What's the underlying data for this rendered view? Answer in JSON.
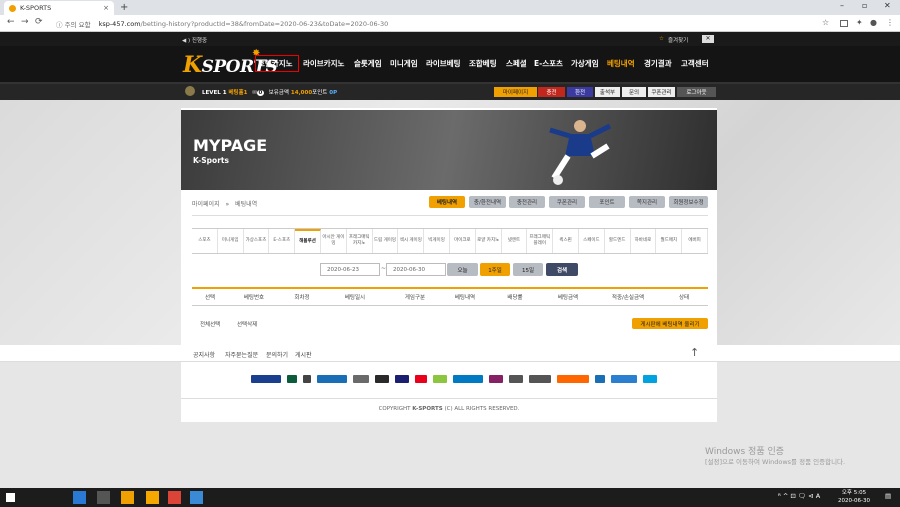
{
  "browser": {
    "tab_title": "K-SPORTS",
    "tab_close": "×",
    "new_tab": "+",
    "minimize": "–",
    "maximize": "▫",
    "close": "✕",
    "back": "←",
    "forward": "→",
    "reload": "⟳",
    "security": "ⓘ 주의 요함",
    "host": "ksp-457.com",
    "path": "/betting-history?productId=38&fromDate=2020-06-23&toDate=2020-06-30",
    "star": "☆",
    "profile": "●",
    "menu": "⋮",
    "icons": [
      "bookmark-star-icon",
      "extensions-icon",
      "profile-icon",
      "more-icon"
    ]
  },
  "site": {
    "top_strip": {
      "notice_label": "◀ ) 진행중",
      "favorite_label": "즐겨찾기",
      "favorite_glyph": "☆"
    },
    "logo": {
      "k": "K",
      "rest": "SPORTS"
    },
    "menu": [
      {
        "label": "호텔카지노",
        "highlight": false
      },
      {
        "label": "라이브카지노",
        "highlight": false
      },
      {
        "label": "슬롯게임",
        "highlight": false
      },
      {
        "label": "미니게임",
        "highlight": false
      },
      {
        "label": "라이브베팅",
        "highlight": false
      },
      {
        "label": "조합베팅",
        "highlight": false
      },
      {
        "label": "스페셜",
        "highlight": false
      },
      {
        "label": "E-스포츠",
        "highlight": false
      },
      {
        "label": "가상게임",
        "highlight": false
      },
      {
        "label": "베팅내역",
        "highlight": true
      },
      {
        "label": "경기결과",
        "highlight": false
      },
      {
        "label": "고객센터",
        "highlight": false
      }
    ],
    "user": {
      "level": "LEVEL 1",
      "nick": "베팅홀1",
      "msg_count": "0",
      "money_label": "보유금액",
      "money": "14,000",
      "point_label": "포인트",
      "point": "0P"
    },
    "user_buttons": [
      "마이페이지",
      "충전",
      "환전",
      "출석부",
      "문의",
      "쿠폰관리",
      "로그아웃"
    ],
    "banner": {
      "title": "MYPAGE",
      "subtitle": "K-Sports"
    },
    "breadcrumb": {
      "root": "마이페이지",
      "sep": "»",
      "current": "베팅내역"
    },
    "page_tabs": [
      {
        "label": "베팅내역",
        "on": true
      },
      {
        "label": "충/환전내역",
        "on": false
      },
      {
        "label": "충전관리",
        "on": false
      },
      {
        "label": "쿠폰관리",
        "on": false
      },
      {
        "label": "포인트",
        "on": false
      },
      {
        "label": "쪽지관리",
        "on": false
      },
      {
        "label": "회원정보수정",
        "on": false
      }
    ],
    "categories": [
      {
        "label": "스포츠",
        "on": false
      },
      {
        "label": "미니게임",
        "on": false
      },
      {
        "label": "가상스포츠",
        "on": false
      },
      {
        "label": "E-스포츠",
        "on": false
      },
      {
        "label": "해볼루션",
        "on": true
      },
      {
        "label": "아시안 게이밍",
        "on": false
      },
      {
        "label": "프래그매틱 카지노",
        "on": false
      },
      {
        "label": "드림 게이밍",
        "on": false
      },
      {
        "label": "섹시 게이밍",
        "on": false
      },
      {
        "label": "빅게이밍",
        "on": false
      },
      {
        "label": "마이크로",
        "on": false
      },
      {
        "label": "로얄 카지노",
        "on": false
      },
      {
        "label": "넷엔트",
        "on": false
      },
      {
        "label": "프래그매틱 플레이",
        "on": false
      },
      {
        "label": "퀵스핀",
        "on": false
      },
      {
        "label": "스페이드",
        "on": false
      },
      {
        "label": "할드엔드",
        "on": false
      },
      {
        "label": "하바네로",
        "on": false
      },
      {
        "label": "월드매치",
        "on": false
      },
      {
        "label": "에버피",
        "on": false
      }
    ],
    "filter": {
      "from": "2020-06-23",
      "tilde": "~",
      "to": "2020-06-30",
      "buttons": [
        {
          "label": "오늘",
          "style": "gray"
        },
        {
          "label": "1주일",
          "style": "on"
        },
        {
          "label": "15일",
          "style": "gray"
        },
        {
          "label": "검색",
          "style": "dark"
        }
      ]
    },
    "table_headers": [
      "선택",
      "베팅번호",
      "회차정",
      "베팅일시",
      "게임구분",
      "베팅내역",
      "배당률",
      "베팅금액",
      "적중/손실금액",
      "상태"
    ],
    "actions": {
      "select_all": "전체선택",
      "delete_selected": "선택삭제",
      "post_button": "게시판에 베팅내역 올리기"
    },
    "footer_links": [
      "공지사항",
      "자주묻는질문",
      "문의하기",
      "게시판"
    ],
    "up_arrow": "↑",
    "payments": [
      {
        "name": "gamblers-anonymous",
        "color": "#1b3f8f"
      },
      {
        "name": "paysafe",
        "color": "#0a5c3a"
      },
      {
        "name": "btc",
        "color": "#444"
      },
      {
        "name": "Nethive",
        "color": "#1a6eb5"
      },
      {
        "name": "gaming-care",
        "color": "#6a6a6a"
      },
      {
        "name": "ecogra",
        "color": "#2a2a2a"
      },
      {
        "name": "VISA",
        "color": "#1a1f71"
      },
      {
        "name": "mastercard",
        "color": "#eb001b"
      },
      {
        "name": "neteller",
        "color": "#8cc63f"
      },
      {
        "name": "paysafecard",
        "color": "#007ac3"
      },
      {
        "name": "Skrill",
        "color": "#862165"
      },
      {
        "name": "entropay",
        "color": "#555"
      },
      {
        "name": "CLICKandBUY",
        "color": "#555"
      },
      {
        "name": "clickandbuy",
        "color": "#ff6600"
      },
      {
        "name": "ECO",
        "color": "#1a6eb5"
      },
      {
        "name": "fundsend",
        "color": "#2a7fd0"
      },
      {
        "name": "ideal",
        "color": "#00a3e0"
      }
    ],
    "copyright_prefix": "COPYRIGHT ",
    "copyright_brand": "K-SPORTS",
    "copyright_suffix": " (C) ALL RIGHTS RESERVED."
  },
  "watermark": {
    "line1": "Windows 정품 인증",
    "line2": "[설정]으로 이동하여 Windows를 정품 인증합니다."
  },
  "taskbar": {
    "apps": [
      "windows-start-icon",
      "search-icon",
      "task-view-icon",
      "edge-icon",
      "calculator-icon",
      "file-explorer-icon",
      "app-icon",
      "chrome-icon",
      "photos-icon"
    ],
    "tray_text": "ᴿ ^ ⊡ 🗨 ⊲ A",
    "time": "오후 5:05",
    "date": "2020-06-30",
    "notify": "▤"
  }
}
